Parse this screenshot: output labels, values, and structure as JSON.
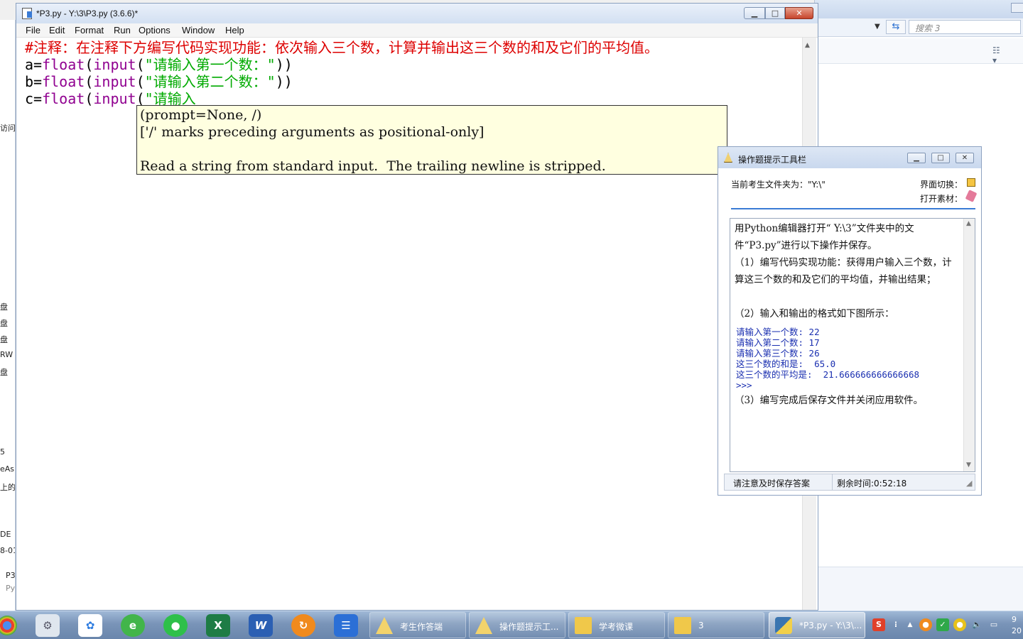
{
  "bg_window": {
    "search_placeholder": "搜索 3"
  },
  "left_strip": {
    "texts": [
      "访问",
      "盘",
      "盘",
      "盘",
      "RW",
      "盘",
      "5",
      "eAs",
      "上的",
      "DE",
      "8-01",
      "P3",
      "Py"
    ]
  },
  "idle": {
    "title": "*P3.py - Y:\\3\\P3.py (3.6.6)*",
    "menu": [
      "File",
      "Edit",
      "Format",
      "Run",
      "Options",
      "Window",
      "Help"
    ],
    "code": {
      "line1_comment": "#注释：在注释下方编写代码实现功能：依次输入三个数，计算并输出这三个数的和及它们的平均值。",
      "line2": {
        "var": "a=",
        "func": "float",
        "p1": "(",
        "builtin": "input",
        "p2": "(",
        "str": "\"请输入第一个数：\"",
        "end": "))"
      },
      "line3": {
        "var": "b=",
        "func": "float",
        "p1": "(",
        "builtin": "input",
        "p2": "(",
        "str": "\"请输入第二个数：\"",
        "end": "))"
      },
      "line4": {
        "var": "c=",
        "func": "float",
        "p1": "(",
        "builtin": "input",
        "p2": "(",
        "str": "\"请输入",
        "end": ""
      }
    },
    "calltip": {
      "line1": "(prompt=None, /)",
      "line2": "['/' marks preceding arguments as positional-only]",
      "line3": "Read a string from standard input.  The trailing newline is stripped."
    }
  },
  "hint": {
    "title": "操作题提示工具栏",
    "folder": "当前考生文件夹为：\"Y:\\\"",
    "switch": "界面切换：",
    "open": "打开素材：",
    "p1": "用Python编辑器打开“ Y:\\3”文件夹中的文件“P3.py”进行以下操作并保存。",
    "p2": "（1）编写代码实现功能：获得用户输入三个数，计算这三个数的和及它们的平均值，并输出结果；",
    "p3": "（2）输入和输出的格式如下图所示：",
    "sample": [
      "请输入第一个数: 22",
      "请输入第二个数: 17",
      "请输入第三个数: 26",
      "这三个数的和是:  65.0",
      "这三个数的平均是:  21.666666666666668",
      ">>>"
    ],
    "p4": "（3）编写完成后保存文件并关闭应用软件。",
    "status_left": "请注意及时保存答案",
    "status_right": "剩余时间:0:52:18"
  },
  "taskbar": {
    "tasks": [
      {
        "label": "考生作答端"
      },
      {
        "label": "操作题提示工..."
      },
      {
        "label": "学考微课"
      },
      {
        "label": "3"
      },
      {
        "label": "*P3.py - Y:\\3\\..."
      }
    ],
    "clock_line1": "9",
    "clock_line2": "20"
  }
}
